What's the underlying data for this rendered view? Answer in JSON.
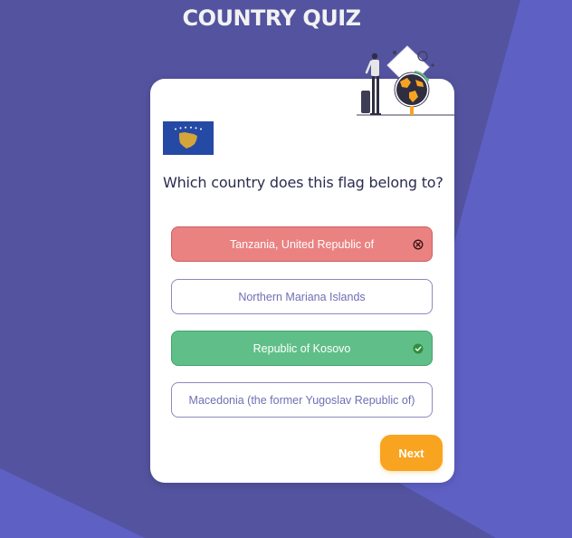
{
  "app": {
    "title": "COUNTRY QUIZ"
  },
  "question": {
    "text": "Which country does this flag belong to?",
    "flag_icon": "kosovo-flag-icon"
  },
  "options": [
    {
      "label": "Tanzania, United Republic of",
      "state": "wrong",
      "icon": "x-circle-icon"
    },
    {
      "label": "Northern Mariana Islands",
      "state": "neutral",
      "icon": ""
    },
    {
      "label": "Republic of Kosovo",
      "state": "correct",
      "icon": "check-circle-icon"
    },
    {
      "label": "Macedonia (the former Yugoslav Republic of)",
      "state": "neutral",
      "icon": ""
    }
  ],
  "actions": {
    "next_label": "Next"
  },
  "colors": {
    "background": "#5353a0",
    "accent_shape": "#5e60c4",
    "wrong": "#ea8282",
    "correct": "#60bf88",
    "neutral_text": "#6f6fb4",
    "next_button": "#f8a420"
  }
}
